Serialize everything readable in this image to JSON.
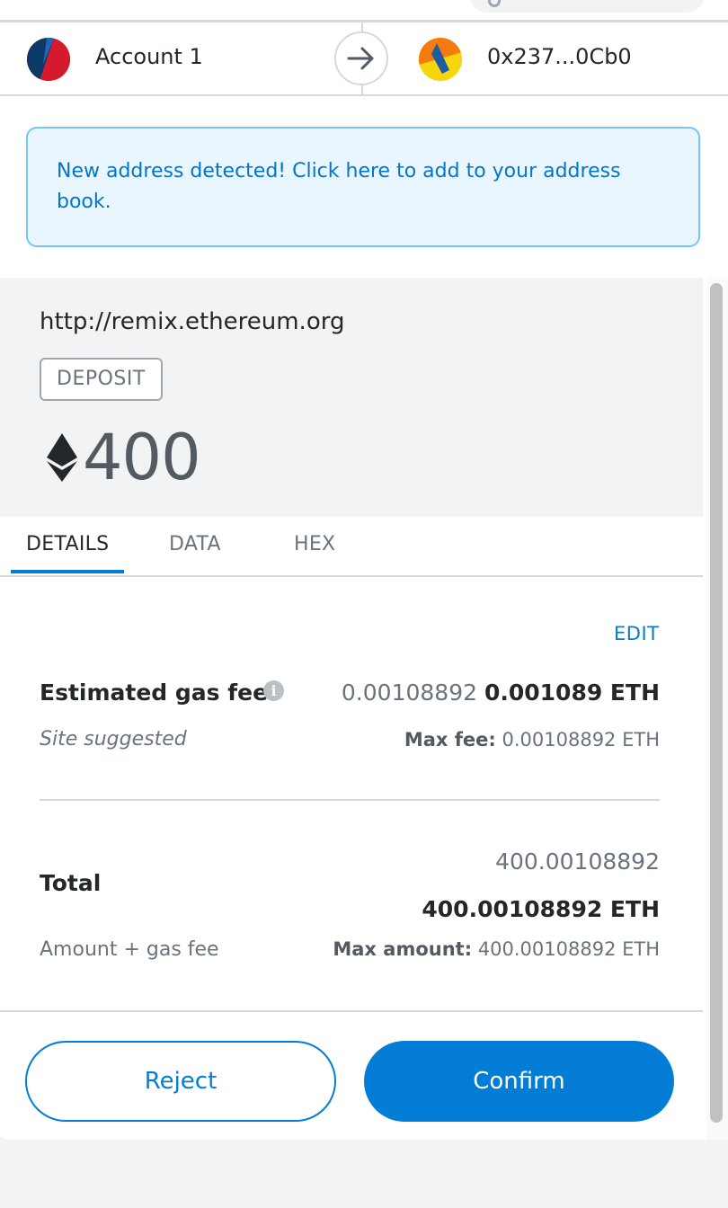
{
  "header": {
    "from_account": "Account 1",
    "to_address": "0x237...0Cb0",
    "arrow_icon": "arrow-right-icon"
  },
  "alert": {
    "text": "New address detected! Click here to add to your address book."
  },
  "summary": {
    "origin": "http://remix.ethereum.org",
    "method": "DEPOSIT",
    "currency_icon": "ethereum-icon",
    "amount": "400"
  },
  "tabs": [
    {
      "label": "DETAILS",
      "active": true
    },
    {
      "label": "DATA",
      "active": false
    },
    {
      "label": "HEX",
      "active": false
    }
  ],
  "details": {
    "edit_label": "EDIT",
    "gas_fee_label": "Estimated gas fee",
    "gas_fee_secondary": "0.00108892",
    "gas_fee_primary": "0.001089 ETH",
    "site_suggested": "Site suggested",
    "max_fee_label": "Max fee:",
    "max_fee_value": "0.00108892 ETH",
    "total_label": "Total",
    "total_secondary": "400.00108892",
    "total_primary": "400.00108892 ETH",
    "amount_gas_label": "Amount + gas fee",
    "max_amount_label": "Max amount:",
    "max_amount_value": "400.00108892 ETH"
  },
  "buttons": {
    "reject": "Reject",
    "confirm": "Confirm"
  },
  "colors": {
    "primary": "#037dd6",
    "alert_bg": "#eaf6ff",
    "alert_border": "#75c4fd",
    "summary_bg": "#f2f3f4"
  }
}
